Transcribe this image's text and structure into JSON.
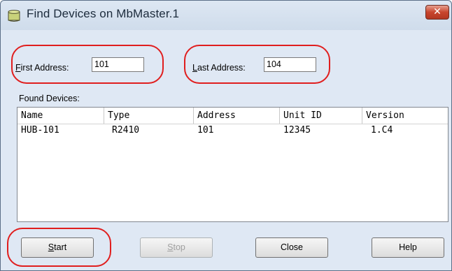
{
  "window": {
    "title": "Find Devices on MbMaster.1",
    "close_glyph": "✕"
  },
  "address": {
    "first_label_key": "F",
    "first_label_rest": "irst Address:",
    "first_value": "101",
    "last_label_key": "L",
    "last_label_rest": "ast Address:",
    "last_value": "104"
  },
  "found_devices_label": "Found Devices:",
  "table": {
    "columns": [
      "Name",
      "Type",
      "Address",
      "Unit ID",
      "Version"
    ],
    "rows": [
      [
        "HUB-101",
        "R2410",
        "101",
        "12345",
        "1.C4"
      ]
    ]
  },
  "buttons": {
    "start_key": "S",
    "start_rest": "tart",
    "stop_key": "S",
    "stop_rest": "top",
    "close": "Close",
    "help": "Help"
  },
  "colors": {
    "highlight": "#e01e1e",
    "close_button": "#c8452d"
  },
  "icons": {
    "app": "database-cylinder-icon",
    "close": "close-icon"
  }
}
